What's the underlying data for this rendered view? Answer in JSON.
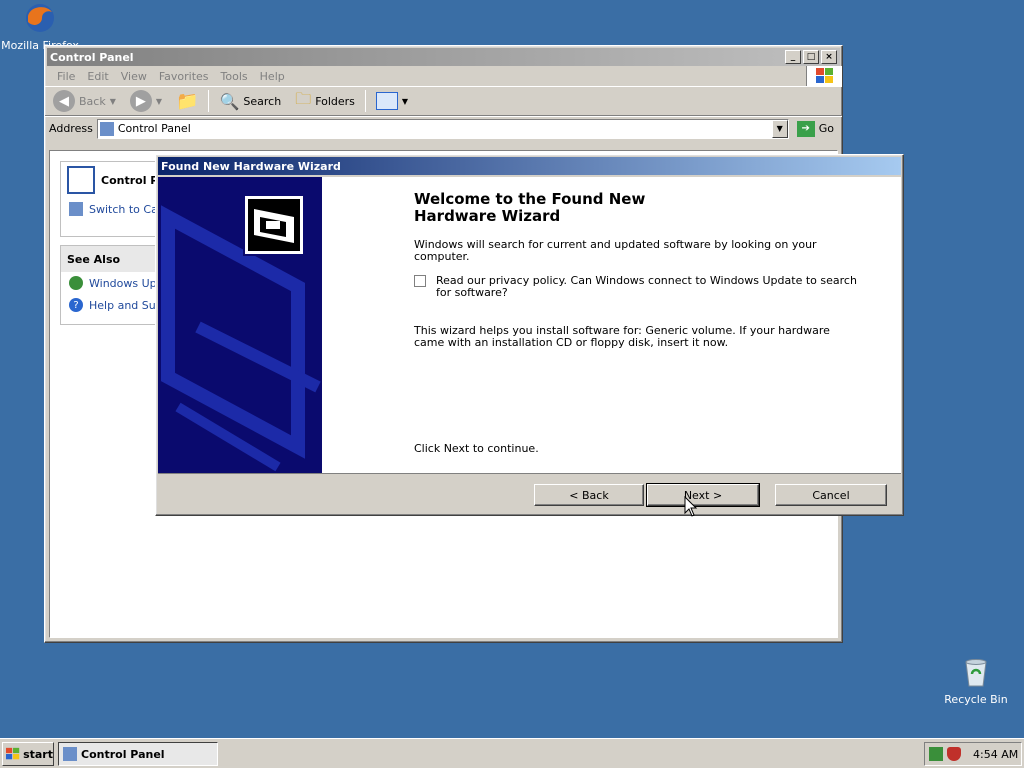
{
  "desktop": {
    "firefox_label": "Mozilla Firefox",
    "recycle_label": "Recycle Bin"
  },
  "control_panel": {
    "title": "Control Panel",
    "menu": [
      "File",
      "Edit",
      "View",
      "Favorites",
      "Tools",
      "Help"
    ],
    "toolbar": {
      "back": "Back",
      "search": "Search",
      "folders": "Folders"
    },
    "address": {
      "label": "Address",
      "value": "Control Panel",
      "go": "Go"
    },
    "panel1": {
      "title": "Control Panel",
      "item": "Switch to Category View"
    },
    "panel2": {
      "title": "See Also",
      "items": [
        "Windows Update",
        "Help and Support"
      ]
    }
  },
  "dialog": {
    "title": "Found New Hardware Wizard",
    "heading_line1": "Welcome to the Found New",
    "heading_line2": "Hardware Wizard",
    "para1": "Windows will search for current and updated software by looking on your computer.",
    "para2": "Read our privacy policy. Can Windows connect to Windows Update to search for software?",
    "para3": "This wizard helps you install software for: Generic volume. If your hardware came with an installation CD or floppy disk, insert it now.",
    "para4": "Click Next to continue.",
    "buttons": {
      "back": "< Back",
      "next": "Next >",
      "cancel": "Cancel"
    }
  },
  "taskbar": {
    "start": "start",
    "task": "Control Panel",
    "clock": "4:54 AM"
  },
  "colors": {
    "desktop": "#3a6ea5",
    "titlebar_active": "#0a246a",
    "wizard_side": "#0a0a6e"
  }
}
